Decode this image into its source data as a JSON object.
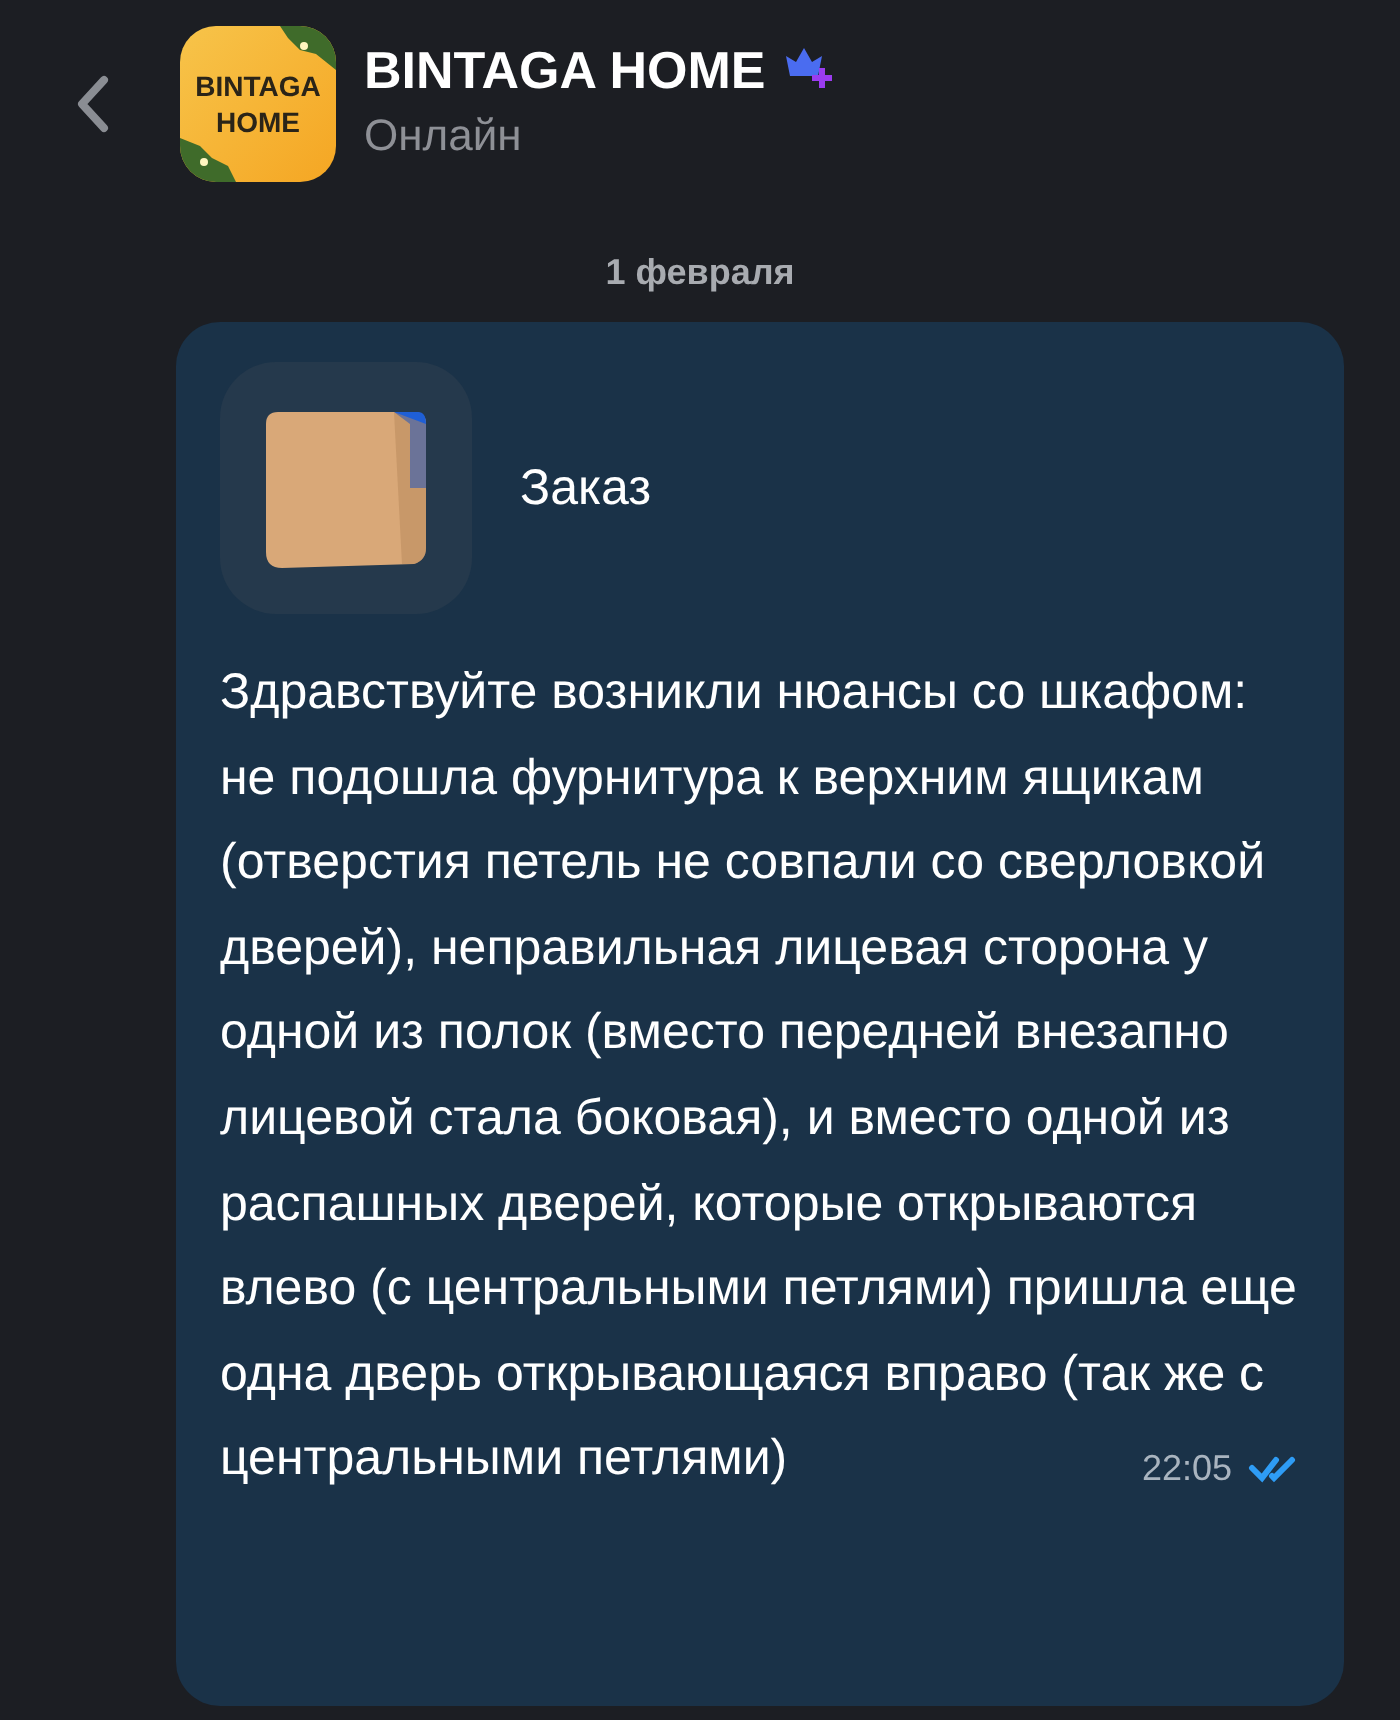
{
  "header": {
    "avatar_text": [
      "BINTAGA",
      "HOME"
    ],
    "title": "BINTAGA HOME",
    "verified": true,
    "status": "Онлайн"
  },
  "date_separator": "1 февраля",
  "message": {
    "card_title": "Заказ",
    "text": "Здравствуйте возникли нюансы со шкафом: не подошла фурнитура к верхним ящикам (отверстия петель не совпали со сверловкой дверей), неправильная лицевая сторона у одной из полок (вместо передней внезапно лицевой стала боковая), и вместо одной из распашных дверей, которые открываются влево (с центральными петлями) пришла еще одна дверь открывающаяся вправо (так же с центральными петлями)",
    "time": "22:05",
    "read": true
  }
}
